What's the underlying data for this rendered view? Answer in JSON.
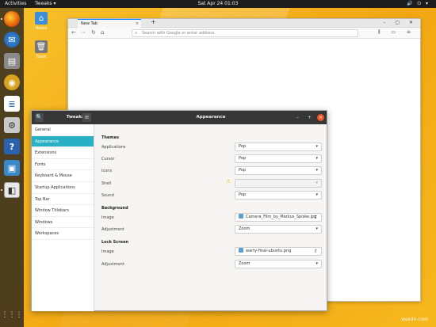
{
  "topbar": {
    "activities": "Activities",
    "app": "Tweaks ▾",
    "clock": "Sat Apr 24  01:03",
    "tray": "🔊 ⏻ ▾"
  },
  "desktop": {
    "icons": [
      {
        "label": "Home"
      },
      {
        "label": "Trash"
      }
    ]
  },
  "dock": {
    "items": [
      "firefox-icon",
      "thunderbird-icon",
      "files-icon",
      "rhythmbox-icon",
      "libreoffice-writer-icon",
      "software-icon",
      "help-icon",
      "screenshot-icon",
      "tweaks-icon"
    ],
    "grid": "⋮⋮⋮"
  },
  "browser": {
    "tab_title": "New Tab",
    "tab_close": "×",
    "new_tab": "+",
    "back": "←",
    "forward": "→",
    "reload": "↻",
    "home": "⌂",
    "url_placeholder": "Search with Google or enter address",
    "tools": "⫼ ▭ ≡",
    "window_controls": "– ▢ ✕"
  },
  "tweaks": {
    "app_name": "Tweaks",
    "title": "Appearance",
    "search_icon": "🔍",
    "menu_icon": "≡",
    "minimize": "–",
    "maximize": "+",
    "close": "×",
    "sidebar": [
      "General",
      "Appearance",
      "Extensions",
      "Fonts",
      "Keyboard & Mouse",
      "Startup Applications",
      "Top Bar",
      "Window Titlebars",
      "Windows",
      "Workspaces"
    ],
    "sections": {
      "themes": "Themes",
      "background": "Background",
      "lock_screen": "Lock Screen"
    },
    "themes_rows": [
      {
        "label": "Applications",
        "value": "Pop"
      },
      {
        "label": "Cursor",
        "value": "Pop"
      },
      {
        "label": "Icons",
        "value": "Pop"
      },
      {
        "label": "Shell",
        "value": ""
      },
      {
        "label": "Sound",
        "value": "Pop"
      }
    ],
    "background_rows": [
      {
        "label": "Image",
        "value": "Camera_Film_by_Markus_Spiske.jpg"
      },
      {
        "label": "Adjustment",
        "value": "Zoom"
      }
    ],
    "lock_rows": [
      {
        "label": "Image",
        "value": "warty-final-ubuntu.png"
      },
      {
        "label": "Adjustment",
        "value": "Zoom"
      }
    ],
    "dropdown_arrow": "▾",
    "upload_arrow": "⇧",
    "warning": "⚠"
  },
  "watermark": "wsxdn.com"
}
